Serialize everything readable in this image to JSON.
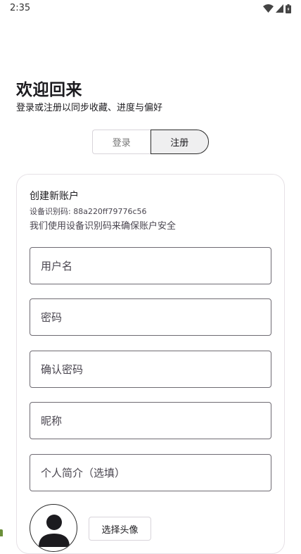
{
  "status_bar": {
    "time": "2:35",
    "icons": [
      "wifi-icon",
      "cellular-signal-icon",
      "battery-icon"
    ]
  },
  "header": {
    "title": "欢迎回来",
    "subtitle": "登录或注册以同步收藏、进度与偏好"
  },
  "tabs": {
    "login_label": "登录",
    "register_label": "注册",
    "selected": "注册"
  },
  "register_card": {
    "title": "创建新账户",
    "device_id": "设备识别码: 88a220ff79776c56",
    "device_note": "我们使用设备识别码来确保账户安全",
    "fields": {
      "username_placeholder": "用户名",
      "password_placeholder": "密码",
      "confirm_password_placeholder": "确认密码",
      "nickname_placeholder": "昵称",
      "bio_placeholder": "个人简介（选填）"
    },
    "choose_avatar_label": "选择头像"
  },
  "colors": {
    "text_primary": "#1c1b1f",
    "text_secondary": "#49454f",
    "outline": "#6e6a72",
    "segment_selected_bg": "#efeff0",
    "card_border": "#e6e1e6"
  }
}
